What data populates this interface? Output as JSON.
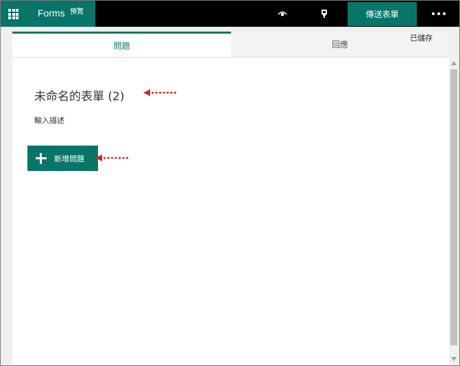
{
  "header": {
    "app_name": "Forms",
    "badge": "預覽",
    "preview_icon": "eye-icon",
    "theme_icon": "paint-bucket-icon",
    "send_label": "傳送表單",
    "more_icon": "ellipsis-icon",
    "brand_color": "#077568"
  },
  "tabs": {
    "questions": "問題",
    "responses": "回應"
  },
  "status": {
    "saved": "已儲存"
  },
  "form": {
    "title": "未命名的表單 (2)",
    "description": "輸入描述",
    "add_question_label": "新增問題"
  },
  "annotations": {
    "arrow_color": "#e02020"
  }
}
